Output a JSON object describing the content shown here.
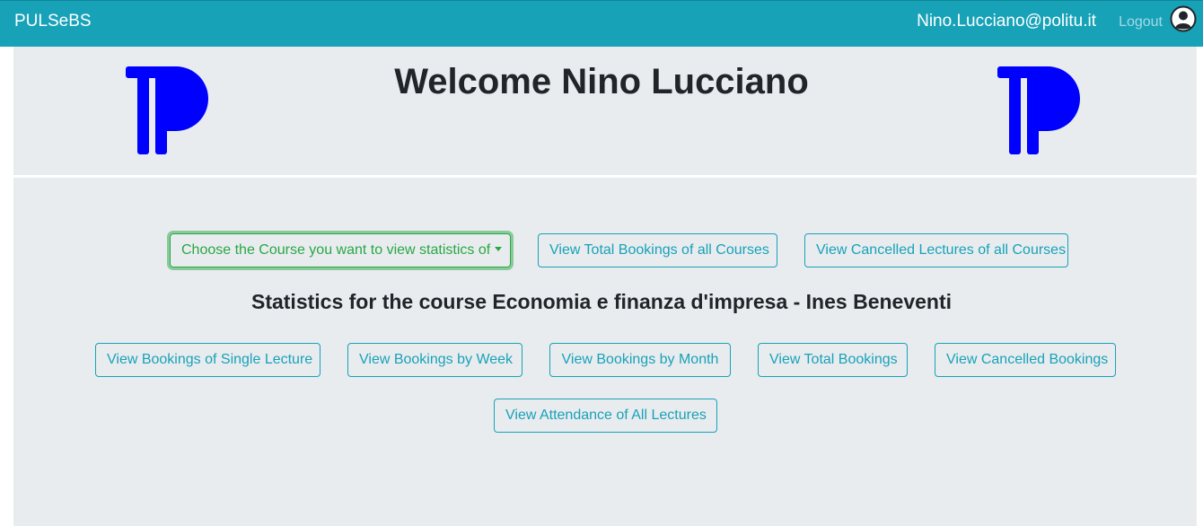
{
  "navbar": {
    "brand": "PULSeBS",
    "user_email": "Nino.Lucciano@politu.it",
    "logout_label": "Logout",
    "user_icon": "user-circle-icon"
  },
  "header": {
    "welcome": "Welcome Nino Lucciano",
    "logo_icon": "polito-logo"
  },
  "controls": {
    "course_dropdown_label": "Choose the Course you want to view statistics of",
    "total_bookings_all_label": "View Total Bookings of all Courses",
    "cancelled_lectures_all_label": "View Cancelled Lectures of all Courses"
  },
  "stats": {
    "title": "Statistics for the course Economia e finanza d'impresa - Ines Beneventi",
    "buttons": [
      "View Bookings of Single Lecture",
      "View Bookings by Week",
      "View Bookings by Month",
      "View Total Bookings",
      "View Cancelled Bookings",
      "View Attendance of All Lectures"
    ]
  },
  "colors": {
    "navbar": "#17a2b8",
    "panel": "#e9ecef",
    "accent_info": "#17a2b8",
    "accent_success": "#28a745",
    "logo": "#0000ff"
  }
}
